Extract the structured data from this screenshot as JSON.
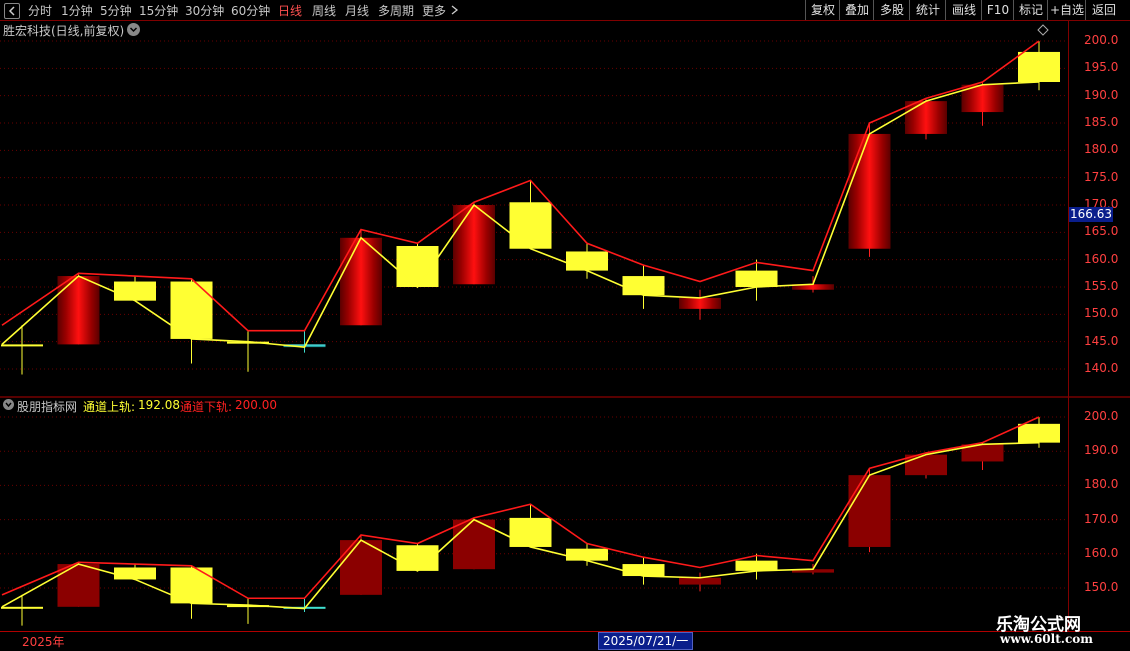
{
  "toolbar": {
    "periods": [
      "分时",
      "1分钟",
      "5分钟",
      "15分钟",
      "30分钟",
      "60分钟",
      "日线",
      "周线",
      "月线",
      "多周期",
      "更多"
    ],
    "active_period": "日线",
    "right_buttons": [
      "复权",
      "叠加",
      "多股",
      "统计",
      "画线",
      "F10",
      "标记",
      "+自选",
      "返回"
    ]
  },
  "main_pane": {
    "title": "胜宏科技(日线,前复权)",
    "last_price_tag": "166.63",
    "y_ticks": [
      "200.0",
      "195.0",
      "190.0",
      "185.0",
      "180.0",
      "175.0",
      "170.0",
      "165.0",
      "160.0",
      "155.0",
      "150.0",
      "145.0",
      "140.0"
    ]
  },
  "indicator_pane": {
    "name": "股朋指标网",
    "upper_label": "通道上轨:",
    "upper_value": "192.08",
    "lower_label": "通道下轨:",
    "lower_value": "200.00",
    "y_ticks": [
      "200.0",
      "190.0",
      "180.0",
      "170.0",
      "160.0",
      "150.0"
    ]
  },
  "bottom_bar": {
    "year_label": "2025年",
    "cursor_date": "2025/07/21/一"
  },
  "watermark": {
    "title": "乐淘公式网",
    "url": "www.60lt.com"
  },
  "colors": {
    "up_line": "#ff1a1a",
    "down_line": "#ffff33",
    "bull_candle": "#ffff33",
    "bear_candle": "#cc0000",
    "flat_candle": "#40e0d0",
    "axis_text": "#ff4040",
    "price_tag_bg": "#0a1e8c"
  },
  "chart_data": {
    "type": "candlestick",
    "candles": [
      {
        "open": 144.5,
        "close": 144.5,
        "high": 148.0,
        "low": 139.0,
        "color": "yellow"
      },
      {
        "open": 157.0,
        "close": 144.5,
        "high": 157.5,
        "low": 144.5,
        "color": "red"
      },
      {
        "open": 152.5,
        "close": 156.0,
        "high": 157.0,
        "low": 152.5,
        "color": "yellow"
      },
      {
        "open": 145.5,
        "close": 156.0,
        "high": 156.5,
        "low": 141.0,
        "color": "yellow"
      },
      {
        "open": 145.0,
        "close": 145.0,
        "high": 147.0,
        "low": 139.5,
        "color": "yellow"
      },
      {
        "open": 144.0,
        "close": 144.5,
        "high": 147.0,
        "low": 143.0,
        "color": "cyan"
      },
      {
        "open": 164.0,
        "close": 148.0,
        "high": 165.5,
        "low": 148.0,
        "color": "red"
      },
      {
        "open": 155.0,
        "close": 162.5,
        "high": 163.0,
        "low": 155.0,
        "color": "yellow"
      },
      {
        "open": 170.0,
        "close": 155.5,
        "high": 170.5,
        "low": 155.5,
        "color": "red"
      },
      {
        "open": 162.0,
        "close": 170.5,
        "high": 174.5,
        "low": 162.0,
        "color": "yellow"
      },
      {
        "open": 158.0,
        "close": 161.5,
        "high": 163.0,
        "low": 156.5,
        "color": "yellow"
      },
      {
        "open": 153.5,
        "close": 157.0,
        "high": 159.0,
        "low": 151.0,
        "color": "yellow"
      },
      {
        "open": 153.0,
        "close": 151.0,
        "high": 154.5,
        "low": 149.0,
        "color": "red"
      },
      {
        "open": 155.0,
        "close": 158.0,
        "high": 160.0,
        "low": 152.5,
        "color": "yellow"
      },
      {
        "open": 155.5,
        "close": 154.5,
        "high": 157.0,
        "low": 154.0,
        "color": "red"
      },
      {
        "open": 183.0,
        "close": 162.0,
        "high": 185.0,
        "low": 160.5,
        "color": "red"
      },
      {
        "open": 189.0,
        "close": 183.0,
        "high": 189.5,
        "low": 182.0,
        "color": "red"
      },
      {
        "open": 192.0,
        "close": 187.0,
        "high": 192.5,
        "low": 184.5,
        "color": "red"
      },
      {
        "open": 192.5,
        "close": 198.0,
        "high": 200.0,
        "low": 191.0,
        "color": "yellow"
      }
    ],
    "upper_line": [
      148.0,
      157.5,
      157.0,
      156.5,
      147.0,
      147.0,
      165.5,
      163.0,
      170.5,
      174.5,
      163.0,
      159.0,
      156.0,
      159.5,
      158.0,
      185.0,
      189.5,
      192.5,
      200.0
    ],
    "lower_line": [
      144.5,
      157.0,
      152.5,
      145.5,
      145.0,
      144.0,
      164.0,
      155.0,
      170.0,
      162.0,
      158.0,
      153.5,
      153.0,
      155.0,
      155.5,
      183.0,
      189.0,
      192.0,
      192.5
    ],
    "ylim": [
      136.5,
      203.0
    ],
    "indicator_ylim": [
      146.0,
      204.0
    ]
  }
}
